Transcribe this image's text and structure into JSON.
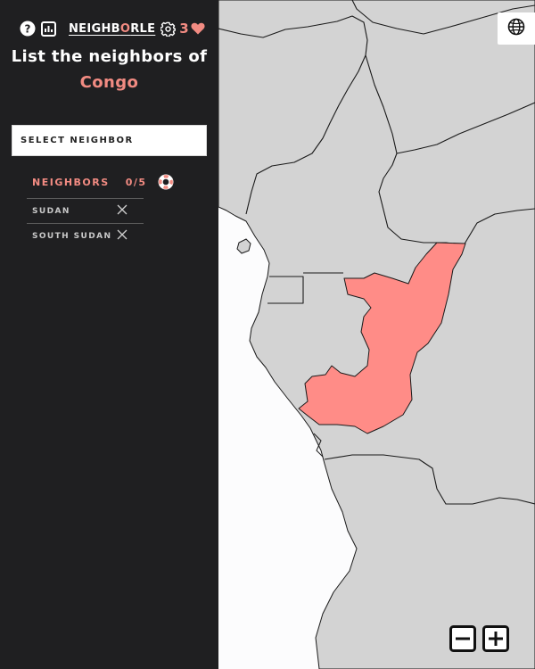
{
  "header": {
    "brand_part1": "NEIGHB",
    "brand_accent": "O",
    "brand_part2": "RLE",
    "lives": "3",
    "icons": [
      "help-icon",
      "stats-icon",
      "settings-icon",
      "heart-icon"
    ]
  },
  "prompt": {
    "text": "List the neighbors of",
    "country": "Congo"
  },
  "select": {
    "placeholder": "SELECT NEIGHBOR"
  },
  "neighbors": {
    "label": "NEIGHBORS",
    "count": "0/5",
    "hint_icon": "lifebuoy-icon",
    "guesses": [
      {
        "name": "SUDAN"
      },
      {
        "name": "SOUTH SUDAN"
      }
    ]
  },
  "map": {
    "highlighted_country": "Congo",
    "controls": [
      "globe-icon",
      "zoom-out-icon",
      "zoom-in-icon"
    ]
  },
  "colors": {
    "sidebar_bg": "#1f1f21",
    "accent": "#f28b82",
    "land": "#d3d3d3",
    "highlight": "#ff8c87",
    "ocean": "#fcfcfd"
  }
}
